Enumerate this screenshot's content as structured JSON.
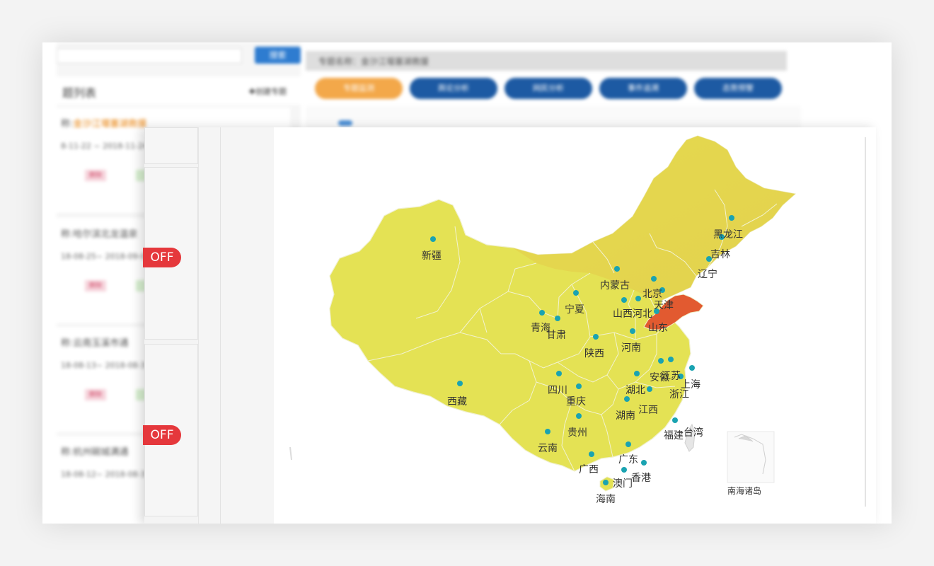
{
  "background_app": {
    "list_title": "题列表",
    "create_label": "✚创建专题",
    "search_button": "搜索",
    "cards": [
      {
        "prefix": "称:",
        "name": "金沙江堰塞湖救援",
        "highlight": true,
        "date": "8-11-22 ~ 2018-11-24"
      },
      {
        "prefix": "称:",
        "name": "哈尔滨北龙温泉",
        "highlight": false,
        "date": "18-08-25~ 2018-09-09"
      },
      {
        "prefix": "称:",
        "name": "云南玉溪市通",
        "highlight": false,
        "date": "18-08-13~ 2018-08-31"
      },
      {
        "prefix": "称:",
        "name": "杭州碗城满通",
        "highlight": false,
        "date": "18-08-12~ 2018-08-31"
      }
    ],
    "delete_label": "删除",
    "topic_bar": "专题名称：金沙江堰塞湖救援",
    "tabs": [
      "专题监测",
      "舆论分析",
      "网民分析",
      "事件追溯",
      "态势预警"
    ],
    "active_tab": 0
  },
  "front_panel": {
    "off_badge": "OFF",
    "off_badge_count": 2
  },
  "map": {
    "type": "china-province-map",
    "colors": {
      "base": "#e4e254",
      "warm": "#e8cf50",
      "hot": "#e25a30",
      "dot": "#1aa3b1",
      "border": "#f0f0cc"
    },
    "highlighted_province": "山东",
    "provinces": [
      "新疆",
      "西藏",
      "青海",
      "甘肃",
      "宁夏",
      "内蒙古",
      "黑龙江",
      "吉林",
      "辽宁",
      "北京",
      "天津",
      "河北",
      "山西",
      "山东",
      "河南",
      "陕西",
      "四川",
      "重庆",
      "湖北",
      "安徽",
      "江苏",
      "上海",
      "浙江",
      "江西",
      "湖南",
      "贵州",
      "云南",
      "广西",
      "广东",
      "福建",
      "台湾",
      "香港",
      "澳门",
      "海南"
    ],
    "inset_label": "南海诸岛"
  }
}
